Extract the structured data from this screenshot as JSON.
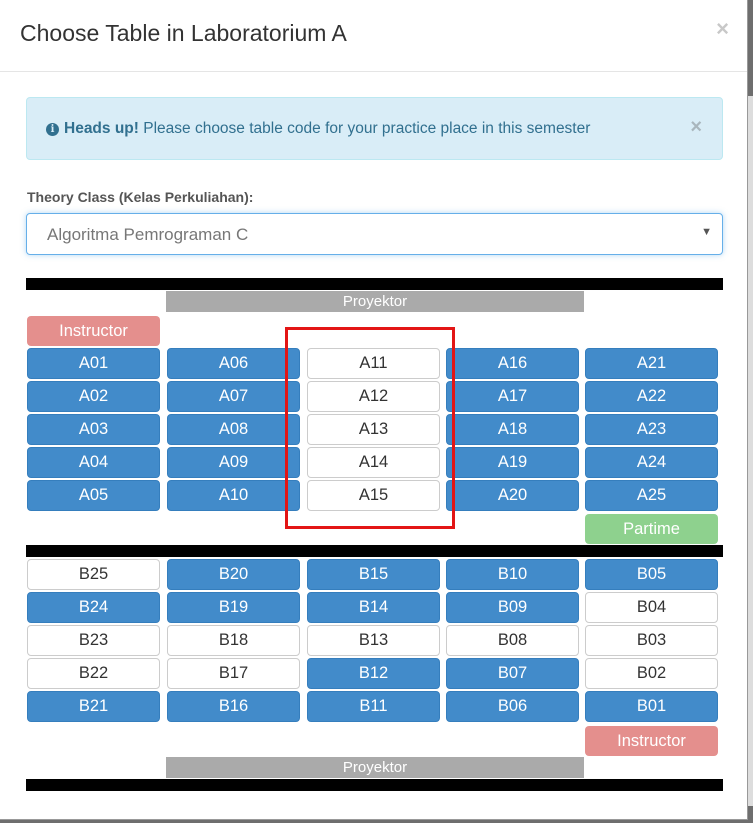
{
  "modal": {
    "title": "Choose Table in Laboratorium A",
    "close": "×"
  },
  "alert": {
    "strong": "Heads up!",
    "text": " Please choose table code for your practice place in this semester",
    "close": "×",
    "icon": "info-icon"
  },
  "theory": {
    "label": "Theory Class (Kelas Perkuliahan):",
    "selected": "Algoritma Pemrograman C"
  },
  "room_a": {
    "projector": "Proyektor",
    "instructor": "Instructor",
    "partime": "Partime",
    "columns": [
      [
        {
          "code": "A01",
          "status": "taken"
        },
        {
          "code": "A02",
          "status": "taken"
        },
        {
          "code": "A03",
          "status": "taken"
        },
        {
          "code": "A04",
          "status": "taken"
        },
        {
          "code": "A05",
          "status": "taken"
        }
      ],
      [
        {
          "code": "A06",
          "status": "taken"
        },
        {
          "code": "A07",
          "status": "taken"
        },
        {
          "code": "A08",
          "status": "taken"
        },
        {
          "code": "A09",
          "status": "taken"
        },
        {
          "code": "A10",
          "status": "taken"
        }
      ],
      [
        {
          "code": "A11",
          "status": "free"
        },
        {
          "code": "A12",
          "status": "free"
        },
        {
          "code": "A13",
          "status": "free"
        },
        {
          "code": "A14",
          "status": "free"
        },
        {
          "code": "A15",
          "status": "free"
        }
      ],
      [
        {
          "code": "A16",
          "status": "taken"
        },
        {
          "code": "A17",
          "status": "taken"
        },
        {
          "code": "A18",
          "status": "taken"
        },
        {
          "code": "A19",
          "status": "taken"
        },
        {
          "code": "A20",
          "status": "taken"
        }
      ],
      [
        {
          "code": "A21",
          "status": "taken"
        },
        {
          "code": "A22",
          "status": "taken"
        },
        {
          "code": "A23",
          "status": "taken"
        },
        {
          "code": "A24",
          "status": "taken"
        },
        {
          "code": "A25",
          "status": "taken"
        }
      ]
    ]
  },
  "room_b": {
    "projector": "Proyektor",
    "instructor": "Instructor",
    "rows": [
      [
        {
          "code": "B25",
          "status": "free"
        },
        {
          "code": "B20",
          "status": "taken"
        },
        {
          "code": "B15",
          "status": "taken"
        },
        {
          "code": "B10",
          "status": "taken"
        },
        {
          "code": "B05",
          "status": "taken"
        }
      ],
      [
        {
          "code": "B24",
          "status": "taken"
        },
        {
          "code": "B19",
          "status": "taken"
        },
        {
          "code": "B14",
          "status": "taken"
        },
        {
          "code": "B09",
          "status": "taken"
        },
        {
          "code": "B04",
          "status": "free"
        }
      ],
      [
        {
          "code": "B23",
          "status": "free"
        },
        {
          "code": "B18",
          "status": "free"
        },
        {
          "code": "B13",
          "status": "free"
        },
        {
          "code": "B08",
          "status": "free"
        },
        {
          "code": "B03",
          "status": "free"
        }
      ],
      [
        {
          "code": "B22",
          "status": "free"
        },
        {
          "code": "B17",
          "status": "free"
        },
        {
          "code": "B12",
          "status": "taken"
        },
        {
          "code": "B07",
          "status": "taken"
        },
        {
          "code": "B02",
          "status": "free"
        }
      ],
      [
        {
          "code": "B21",
          "status": "taken"
        },
        {
          "code": "B16",
          "status": "taken"
        },
        {
          "code": "B11",
          "status": "taken"
        },
        {
          "code": "B06",
          "status": "taken"
        },
        {
          "code": "B01",
          "status": "taken"
        }
      ]
    ]
  },
  "colors": {
    "taken": "#428bca",
    "free": "#ffffff",
    "instructor": "#e48f8d",
    "partime": "#8ed18e",
    "highlight": "#e31515"
  }
}
